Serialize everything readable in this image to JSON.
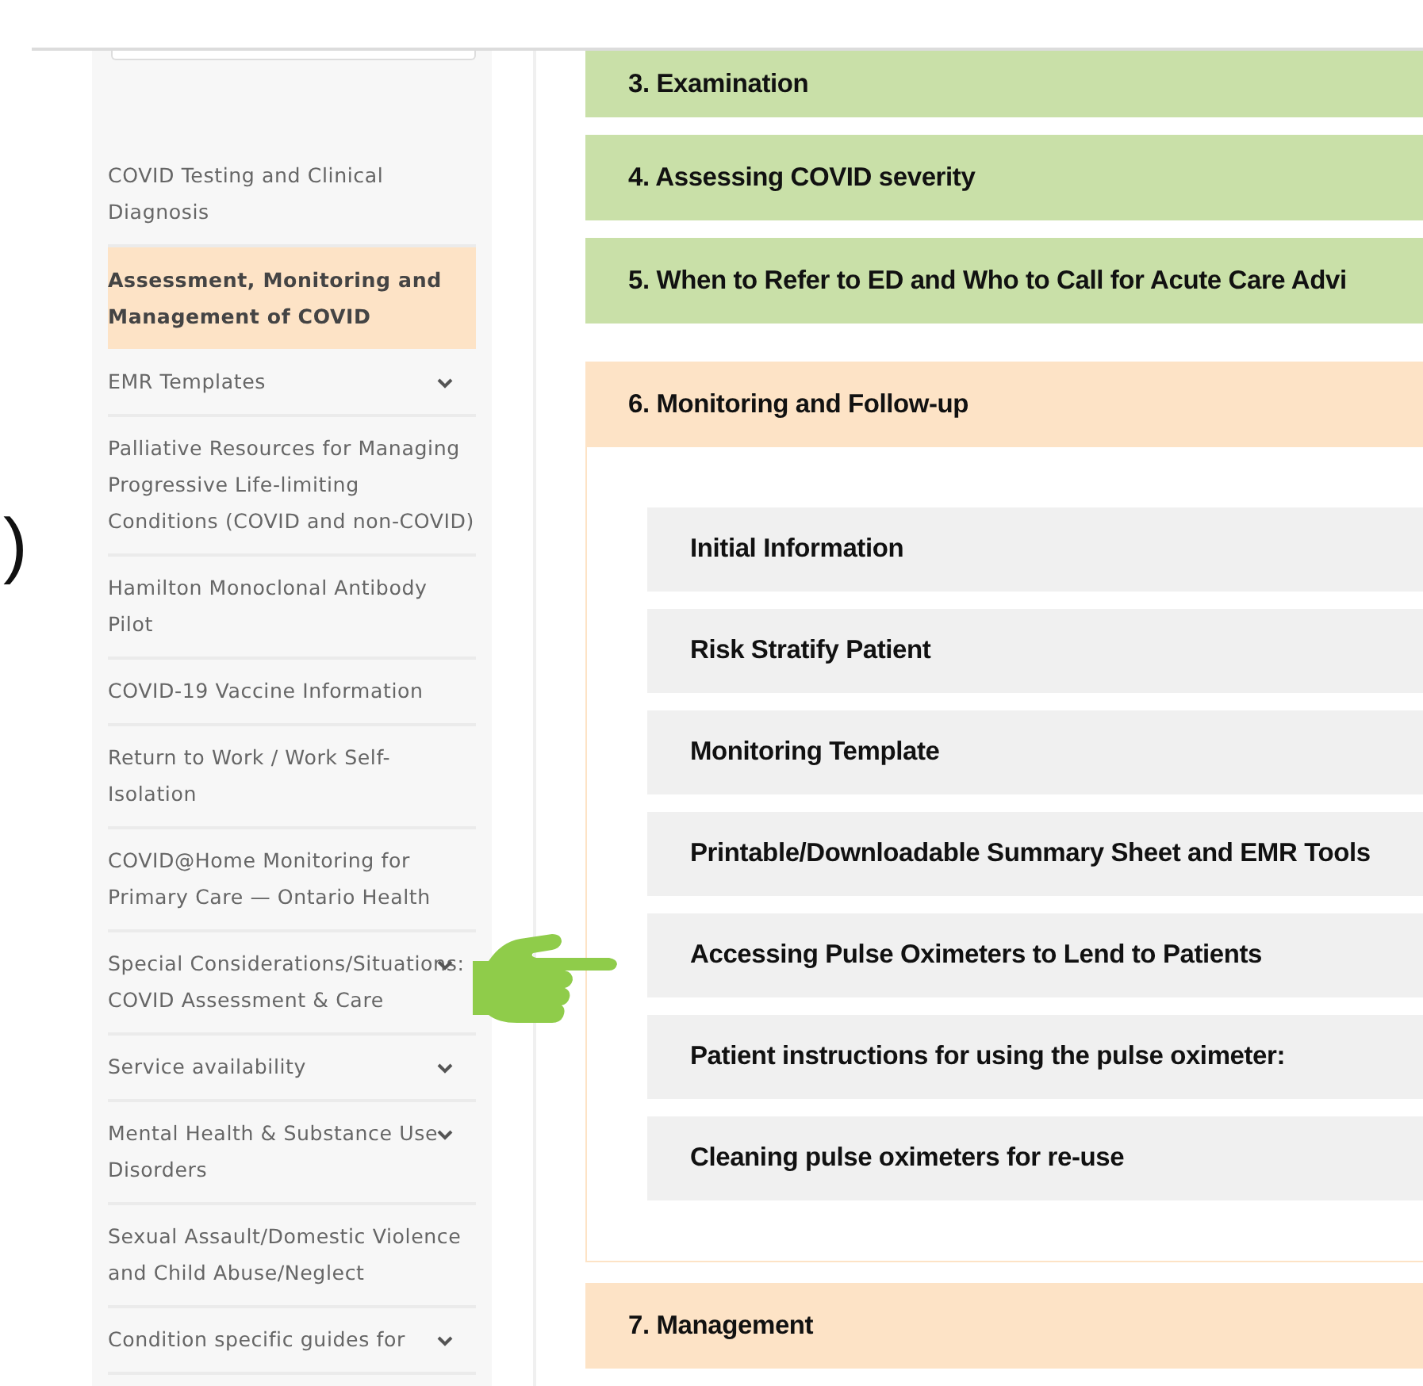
{
  "cut_heading": ")",
  "sidebar": {
    "items": [
      {
        "label": "COVID Testing and Clinical Diagnosis",
        "selected": false,
        "has_submenu": false
      },
      {
        "label": "Assessment, Monitoring and Management of COVID",
        "selected": true,
        "has_submenu": false
      },
      {
        "label": "EMR Templates",
        "selected": false,
        "has_submenu": true
      },
      {
        "label": "Palliative Resources for Managing Progressive Life-limiting Conditions (COVID and non-COVID)",
        "selected": false,
        "has_submenu": false
      },
      {
        "label": "Hamilton Monoclonal Antibody Pilot",
        "selected": false,
        "has_submenu": false
      },
      {
        "label": "COVID-19 Vaccine Information",
        "selected": false,
        "has_submenu": false
      },
      {
        "label": "Return to Work / Work Self-Isolation",
        "selected": false,
        "has_submenu": false
      },
      {
        "label": "COVID@Home Monitoring for Primary Care — Ontario Health",
        "selected": false,
        "has_submenu": false
      },
      {
        "label": "Special Considerations/Situations: COVID Assessment & Care",
        "selected": false,
        "has_submenu": true
      },
      {
        "label": "Service availability",
        "selected": false,
        "has_submenu": true
      },
      {
        "label": "Mental Health & Substance Use Disorders",
        "selected": false,
        "has_submenu": true
      },
      {
        "label": "Sexual Assault/Domestic Violence and Child Abuse/Neglect",
        "selected": false,
        "has_submenu": false
      },
      {
        "label": "Condition specific guides for",
        "selected": false,
        "has_submenu": true
      }
    ]
  },
  "sections": [
    {
      "title": "3. Examination",
      "color": "#c9e0a8"
    },
    {
      "title": "4. Assessing COVID severity",
      "color": "#c9e0a8"
    },
    {
      "title": "5. When to Refer to ED and Who to Call for Acute Care Advi",
      "color": "#c9e0a8"
    },
    {
      "title": "6. Monitoring and Follow-up",
      "color": "#fde3c6",
      "subsections": [
        "Initial Information",
        "Risk Stratify Patient",
        "Monitoring Template",
        "Printable/Downloadable Summary Sheet and EMR Tools",
        "Accessing Pulse Oximeters to Lend to Patients",
        "Patient instructions for using the pulse oximeter:",
        "Cleaning pulse oximeters for re-use"
      ]
    },
    {
      "title": "7. Management",
      "color": "#fde3c6"
    }
  ]
}
